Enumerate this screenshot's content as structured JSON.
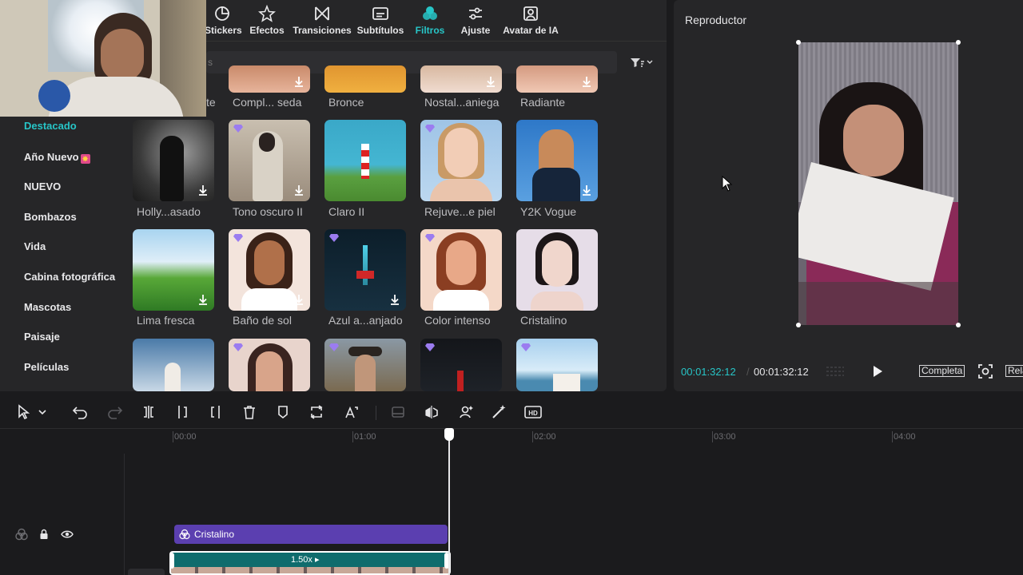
{
  "tabs": [
    {
      "label": "Stickers",
      "icon": "sticker-icon",
      "active": false
    },
    {
      "label": "Efectos",
      "icon": "star-icon",
      "active": false
    },
    {
      "label": "Transiciones",
      "icon": "transition-icon",
      "active": false
    },
    {
      "label": "Subtítulos",
      "icon": "subtitle-icon",
      "active": false
    },
    {
      "label": "Filtros",
      "icon": "filter-icon",
      "active": true
    },
    {
      "label": "Ajuste",
      "icon": "sliders-icon",
      "active": false
    },
    {
      "label": "Avatar de IA",
      "icon": "avatar-icon",
      "active": false
    }
  ],
  "search": {
    "placeholder": "s"
  },
  "sidebar": {
    "items": [
      {
        "label": "Destacado",
        "active": true
      },
      {
        "label": "Año Nuevo",
        "badge": "sparkle-icon",
        "active": false
      },
      {
        "label": "NUEVO",
        "active": false
      },
      {
        "label": "Bombazos",
        "active": false
      },
      {
        "label": "Vida",
        "active": false
      },
      {
        "label": "Cabina fotográfica",
        "active": false
      },
      {
        "label": "Mascotas",
        "active": false
      },
      {
        "label": "Paisaje",
        "active": false
      },
      {
        "label": "Películas",
        "active": false
      }
    ]
  },
  "filters": {
    "row0": [
      "te",
      "Compl... seda",
      "Bronce",
      "Nostal...aniega",
      "Radiante"
    ],
    "row1": [
      "Holly...asado",
      "Tono oscuro II",
      "Claro II",
      "Rejuve...e piel",
      "Y2K Vogue"
    ],
    "row2": [
      "Lima fresca",
      "Baño de sol",
      "Azul a...anjado",
      "Color intenso",
      "Cristalino"
    ]
  },
  "player": {
    "title": "Reproductor",
    "current_time": "00:01:32:12",
    "total_time": "00:01:32:12",
    "complete_label": "Completa",
    "ratio_label": "Rela"
  },
  "timeline": {
    "ticks": [
      "00:00",
      "01:00",
      "02:00",
      "03:00",
      "04:00"
    ],
    "filter_clip_label": "Cristalino",
    "speed_label": "1.50x"
  },
  "colors": {
    "accent": "#27c5c7",
    "filter_clip": "#5b3fb0",
    "video_clip": "#0f6c6d"
  }
}
